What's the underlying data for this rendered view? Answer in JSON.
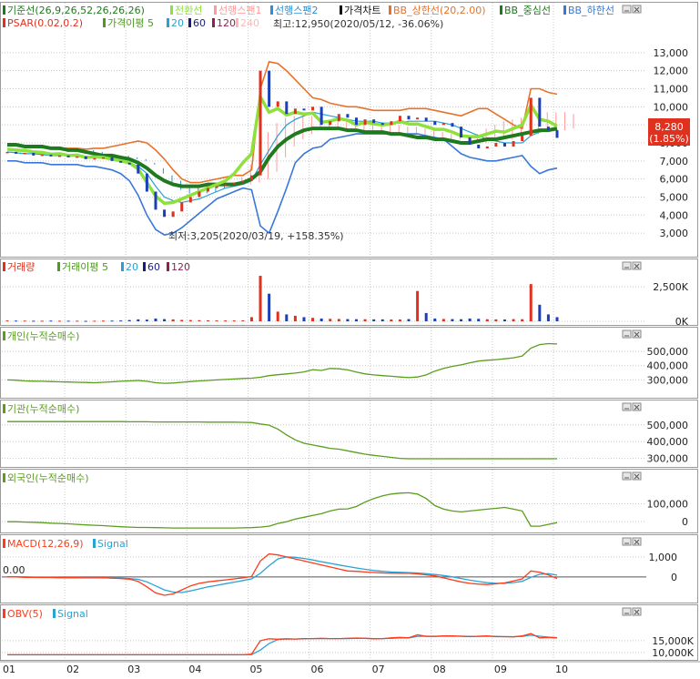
{
  "colors": {
    "up": "#e0301e",
    "down": "#1c3fb8",
    "ma5": "#4d9a1e",
    "ma20": "#2a9fd6",
    "ma60": "#1b1b80",
    "ma120": "#8b2252",
    "ma240": "#ffb6b6",
    "kijun": "#1f7a1f",
    "tenkan": "#8ee03a",
    "cloud1": "#ff9a9a",
    "cloud2": "#2a8fd6",
    "bb_upper": "#e8722a",
    "bb_lower": "#3a78d8",
    "green_line": "#5a9e1e",
    "macd": "#ff3b1a",
    "signal": "#29a3d6",
    "grid": "#c8c8c8",
    "price_tag_bg": "#e0301e"
  },
  "icons": {
    "panel_minimize": "minimize-icon",
    "panel_close": "close-icon"
  },
  "chart_data": [
    {
      "type": "candlestick",
      "legend_row1": [
        "기준선(26,9,26,52,26,26,26)",
        "전환선",
        "선행스팬1",
        "선행스팬2",
        "가격차트",
        "BB_상한선(20,2.00)",
        "BB_중심선",
        "BB_하한선"
      ],
      "legend_row2": [
        "PSAR(0.02,0.2)",
        "가격이평 5",
        "20",
        "60",
        "120",
        "240"
      ],
      "annotation_high": "최고:12,950(2020/05/12, -36.06%)",
      "annotation_low": "최저:3,205(2020/03/19, +158.35%)",
      "current_price": "8,280",
      "current_change": "(1.85%)",
      "y_ticks": [
        "13,000",
        "12,000",
        "11,000",
        "10,000",
        "9,000",
        "8,000",
        "7,000",
        "6,000",
        "5,000",
        "4,000",
        "3,000"
      ],
      "ylim": [
        2300,
        13800
      ],
      "x": [
        "01",
        "01",
        "01",
        "01",
        "01",
        "01",
        "01",
        "02",
        "02",
        "02",
        "02",
        "02",
        "02",
        "02",
        "03",
        "03",
        "03",
        "03",
        "03",
        "03",
        "03",
        "04",
        "04",
        "04",
        "04",
        "04",
        "04",
        "04",
        "05",
        "05",
        "05",
        "05",
        "05",
        "05",
        "05",
        "06",
        "06",
        "06",
        "06",
        "06",
        "06",
        "06",
        "07",
        "07",
        "07",
        "07",
        "07",
        "07",
        "07",
        "08",
        "08",
        "08",
        "08",
        "08",
        "08",
        "08",
        "09",
        "09",
        "09",
        "09",
        "09",
        "09",
        "09",
        "10"
      ],
      "close": [
        7500,
        7400,
        7450,
        7300,
        7350,
        7250,
        7300,
        7200,
        7250,
        7100,
        7150,
        7200,
        7000,
        6900,
        6800,
        6300,
        5300,
        4300,
        3900,
        4200,
        4700,
        5000,
        5300,
        5500,
        5600,
        5700,
        5800,
        5900,
        6200,
        12000,
        10000,
        10300,
        9600,
        9900,
        9800,
        10000,
        9000,
        9200,
        9600,
        9400,
        9000,
        9300,
        9100,
        9000,
        9200,
        9500,
        9300,
        9400,
        9200,
        9000,
        9100,
        8900,
        8300,
        7900,
        7700,
        7800,
        8000,
        7800,
        8100,
        8400,
        10500,
        8900,
        8700,
        8280
      ],
      "ichimoku_cloud_span1": [
        7800,
        7800,
        7700,
        7700,
        7600,
        7500,
        7500,
        7400,
        7400,
        7300,
        7300,
        7200,
        7200,
        7100,
        7000,
        6800,
        6300,
        5800,
        5400,
        5200,
        5100,
        5200,
        5300,
        5500,
        5800,
        6100,
        6800,
        7900,
        8600,
        9100,
        9400,
        9500,
        9500,
        9500,
        9400,
        9300,
        9300,
        9200,
        9100,
        9100,
        9000,
        9000,
        9000,
        9000,
        8900,
        8900,
        8800,
        8700,
        8600,
        8500,
        8400,
        8300,
        8500,
        8800,
        9000,
        9200,
        9300,
        9400,
        9500,
        9600,
        9700,
        9700,
        9700,
        9600
      ],
      "ichimoku_cloud_span2": [
        7900,
        7900,
        7800,
        7800,
        7800,
        7700,
        7700,
        7600,
        7600,
        7500,
        7400,
        7300,
        7300,
        7200,
        7100,
        6900,
        6600,
        6200,
        5900,
        5700,
        5600,
        5600,
        5600,
        5700,
        5700,
        5700,
        5700,
        5800,
        6000,
        6400,
        7200,
        7800,
        8200,
        8500,
        8700,
        8800,
        8800,
        8800,
        8800,
        8700,
        8700,
        8600,
        8600,
        8600,
        8500,
        8500,
        8400,
        8300,
        8300,
        8200,
        8200,
        8100,
        8000,
        8000,
        8100,
        8200,
        8200,
        8300,
        8400,
        8500,
        8600,
        8700,
        8700,
        8800
      ],
      "bb_upper": [
        7900,
        7850,
        7800,
        7800,
        7750,
        7750,
        7700,
        7700,
        7700,
        7650,
        7700,
        7700,
        7800,
        7900,
        8000,
        8100,
        8000,
        7600,
        7100,
        6500,
        6000,
        5800,
        5800,
        5900,
        6000,
        6100,
        6200,
        6200,
        6500,
        11000,
        12500,
        12400,
        12000,
        11500,
        11000,
        10500,
        10400,
        10200,
        10100,
        10000,
        10000,
        9900,
        9800,
        9800,
        9800,
        9800,
        9900,
        9900,
        9900,
        9800,
        9700,
        9600,
        9500,
        9700,
        9900,
        9900,
        9600,
        9300,
        9000,
        8800,
        11000,
        11000,
        10800,
        10700
      ],
      "bb_lower": [
        7000,
        7000,
        6900,
        6900,
        6900,
        6800,
        6800,
        6800,
        6800,
        6700,
        6700,
        6600,
        6500,
        6300,
        5900,
        5100,
        4000,
        3200,
        2900,
        3000,
        3300,
        3700,
        4100,
        4500,
        4900,
        5100,
        5300,
        5500,
        5400,
        3400,
        3000,
        4200,
        5500,
        6900,
        7400,
        7700,
        7800,
        8200,
        8300,
        8400,
        8500,
        8500,
        8500,
        8500,
        8500,
        8500,
        8500,
        8500,
        8400,
        8300,
        8200,
        7800,
        7400,
        7200,
        7100,
        7000,
        7000,
        7100,
        7200,
        7300,
        6700,
        6300,
        6500,
        6600
      ],
      "ma20": [
        7500,
        7450,
        7400,
        7400,
        7350,
        7300,
        7300,
        7300,
        7250,
        7200,
        7200,
        7150,
        7100,
        7000,
        6900,
        6700,
        6300,
        5600,
        5000,
        4800,
        4700,
        4800,
        4900,
        5100,
        5300,
        5500,
        5600,
        5700,
        5900,
        6800,
        7600,
        8400,
        9000,
        9300,
        9500,
        9700,
        9600,
        9500,
        9400,
        9300,
        9200,
        9200,
        9200,
        9100,
        9100,
        9100,
        9200,
        9200,
        9200,
        9200,
        9100,
        9000,
        8800,
        8600,
        8400,
        8200,
        8100,
        8000,
        8000,
        8000,
        8400,
        8600,
        8700,
        8700
      ]
    },
    {
      "type": "bar",
      "legend": [
        "거래량",
        "거래이평 5",
        "20",
        "60",
        "120"
      ],
      "y_ticks": [
        "2,500K",
        "0K"
      ],
      "ylim": [
        0,
        3500
      ],
      "values": [
        60,
        50,
        50,
        40,
        40,
        50,
        40,
        40,
        40,
        30,
        40,
        50,
        50,
        60,
        90,
        140,
        120,
        200,
        160,
        140,
        100,
        90,
        80,
        70,
        60,
        60,
        60,
        70,
        300,
        3300,
        2000,
        700,
        500,
        400,
        300,
        250,
        200,
        180,
        170,
        160,
        150,
        150,
        140,
        140,
        130,
        130,
        160,
        2200,
        600,
        200,
        170,
        160,
        150,
        200,
        180,
        150,
        140,
        130,
        160,
        150,
        2700,
        1200,
        500,
        300
      ]
    },
    {
      "type": "line",
      "legend": "개인(누적순매수)",
      "y_ticks": [
        "500,000",
        "400,000",
        "300,000"
      ],
      "ylim": [
        200000,
        590000
      ],
      "values": [
        300000,
        298000,
        293000,
        291000,
        290000,
        288000,
        286000,
        285000,
        283000,
        282000,
        280000,
        283000,
        286000,
        290000,
        293000,
        296000,
        290000,
        280000,
        276000,
        278000,
        283000,
        288000,
        293000,
        296000,
        300000,
        303000,
        306000,
        310000,
        312000,
        318000,
        330000,
        336000,
        342000,
        348000,
        356000,
        372000,
        366000,
        380000,
        378000,
        370000,
        355000,
        342000,
        335000,
        330000,
        325000,
        320000,
        316000,
        320000,
        335000,
        362000,
        380000,
        395000,
        405000,
        420000,
        432000,
        438000,
        442000,
        448000,
        455000,
        468000,
        523000,
        548000,
        555000,
        552000
      ]
    },
    {
      "type": "line",
      "legend": "기관(누적순매수)",
      "y_ticks": [
        "500,000",
        "400,000",
        "300,000"
      ],
      "ylim": [
        260000,
        580000
      ],
      "values": [
        519000,
        519000,
        519000,
        519000,
        519000,
        519000,
        519000,
        519000,
        519000,
        519000,
        519000,
        519000,
        519000,
        519000,
        518000,
        518000,
        518000,
        517000,
        517000,
        517000,
        517000,
        517000,
        517000,
        516000,
        516000,
        516000,
        516000,
        515000,
        514000,
        505000,
        498000,
        475000,
        440000,
        410000,
        390000,
        380000,
        370000,
        360000,
        355000,
        345000,
        335000,
        325000,
        318000,
        312000,
        306000,
        300000,
        298000,
        298000,
        298000,
        298000,
        298000,
        298000,
        298000,
        298000,
        298000,
        298000,
        298000,
        298000,
        298000,
        298000,
        298000,
        298000,
        298000,
        298000
      ]
    },
    {
      "type": "line",
      "legend": "외국인(누적순매수)",
      "y_ticks": [
        "100,000",
        "0"
      ],
      "ylim": [
        -50000,
        220000
      ],
      "values": [
        0,
        0,
        -2000,
        -3000,
        -5000,
        -8000,
        -10000,
        -12000,
        -15000,
        -18000,
        -20000,
        -22000,
        -25000,
        -28000,
        -30000,
        -32000,
        -32000,
        -33000,
        -34000,
        -35000,
        -35000,
        -35000,
        -35000,
        -35000,
        -35000,
        -35000,
        -35000,
        -34000,
        -33000,
        -30000,
        -25000,
        -10000,
        0,
        15000,
        25000,
        35000,
        45000,
        60000,
        70000,
        72000,
        85000,
        110000,
        130000,
        145000,
        155000,
        160000,
        162000,
        155000,
        130000,
        90000,
        70000,
        60000,
        55000,
        60000,
        65000,
        70000,
        75000,
        80000,
        70000,
        60000,
        -25000,
        -25000,
        -15000,
        -5000
      ]
    },
    {
      "type": "line",
      "legend": [
        "MACD(12,26,9)",
        "Signal"
      ],
      "level_label": "0.00",
      "y_ticks": [
        "1,000",
        "0"
      ],
      "ylim": [
        -1100,
        1450
      ],
      "macd": [
        0,
        0,
        -20,
        -20,
        -30,
        -30,
        -40,
        -40,
        -40,
        -50,
        -50,
        -40,
        -60,
        -80,
        -110,
        -220,
        -500,
        -800,
        -920,
        -850,
        -650,
        -450,
        -320,
        -250,
        -200,
        -150,
        -100,
        -50,
        20,
        800,
        1150,
        1100,
        1000,
        900,
        800,
        700,
        600,
        500,
        400,
        300,
        280,
        250,
        220,
        200,
        190,
        180,
        180,
        150,
        100,
        50,
        -50,
        -150,
        -250,
        -320,
        -360,
        -380,
        -340,
        -300,
        -200,
        -100,
        300,
        240,
        100,
        -80
      ],
      "signal": [
        0,
        0,
        0,
        -10,
        -20,
        -20,
        -30,
        -30,
        -30,
        -40,
        -40,
        -40,
        -50,
        -60,
        -80,
        -120,
        -250,
        -450,
        -650,
        -760,
        -780,
        -700,
        -600,
        -500,
        -420,
        -340,
        -260,
        -180,
        -100,
        180,
        560,
        900,
        1000,
        980,
        920,
        850,
        760,
        680,
        600,
        520,
        450,
        380,
        320,
        280,
        250,
        230,
        210,
        200,
        160,
        120,
        70,
        0,
        -80,
        -160,
        -230,
        -290,
        -320,
        -320,
        -280,
        -220,
        -20,
        130,
        160,
        90
      ]
    },
    {
      "type": "line",
      "legend": [
        "OBV(5)",
        "Signal"
      ],
      "y_ticks": [
        "15,000K",
        "10,000K"
      ],
      "ylim": [
        8000,
        25000
      ],
      "obv": [
        9000,
        9000,
        9000,
        9000,
        9000,
        9000,
        9000,
        9000,
        9000,
        9000,
        9000,
        9000,
        9000,
        9000,
        9000,
        9000,
        9000,
        9000,
        9000,
        9000,
        9000,
        9000,
        9000,
        9000,
        9000,
        9000,
        9000,
        9000,
        9300,
        15000,
        15800,
        15600,
        15800,
        15700,
        15900,
        15900,
        16000,
        15900,
        15900,
        16000,
        16100,
        16000,
        15800,
        15900,
        16200,
        16400,
        16200,
        17500,
        16800,
        16800,
        17000,
        17000,
        16900,
        16700,
        16900,
        17000,
        16700,
        16700,
        16600,
        17000,
        18000,
        16200,
        16400,
        16200
      ],
      "signal": [
        9000,
        9000,
        9000,
        9000,
        9000,
        9000,
        9000,
        9000,
        9000,
        9000,
        9000,
        9000,
        9000,
        9000,
        9000,
        9000,
        9000,
        9000,
        9000,
        9000,
        9000,
        9000,
        9000,
        9000,
        9000,
        9000,
        9000,
        9000,
        9100,
        11000,
        13800,
        15500,
        15700,
        15700,
        15800,
        15900,
        15900,
        15900,
        15900,
        15900,
        16000,
        16000,
        15900,
        15900,
        16000,
        16200,
        16200,
        16800,
        16900,
        16900,
        16900,
        16900,
        16900,
        16800,
        16800,
        16900,
        16800,
        16700,
        16700,
        16800,
        17300,
        16900,
        16500,
        16300
      ]
    }
  ],
  "x_ticks": [
    "01",
    "02",
    "03",
    "04",
    "05",
    "06",
    "07",
    "08",
    "09",
    "10"
  ]
}
